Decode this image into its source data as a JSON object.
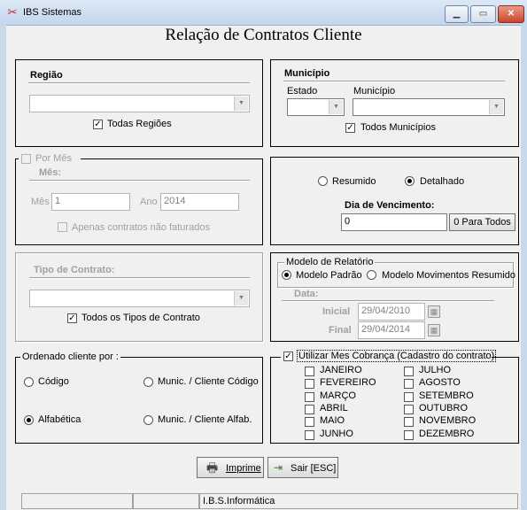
{
  "window": {
    "title": "IBS Sistemas",
    "app_icon": "ibs-logo-icon",
    "min": "▁",
    "max": "▭",
    "close": "✕"
  },
  "form_title": "Relação de Contratos Cliente",
  "regiao": {
    "title": "Região",
    "value": "",
    "todas_label": "Todas Regiões",
    "todas_checked": true
  },
  "municipio": {
    "title": "Município",
    "estado_label": "Estado",
    "municipio_label": "Município",
    "todos_label": "Todos Municípios",
    "todos_checked": true
  },
  "por_mes": {
    "legend": "Por Mês",
    "checked": false,
    "section": "Mês:",
    "mes_label": "Mês",
    "mes_value": "1",
    "ano_label": "Ano",
    "ano_value": "2014",
    "apenas_label": "Apenas contratos não faturados"
  },
  "tipo_saida": {
    "resumido": "Resumido",
    "detalhado": "Detalhado",
    "selected": "Detalhado",
    "dia_label": "Dia de Vencimento:",
    "dia_value": "0",
    "zero_button": "0 Para Todos"
  },
  "tipo_contrato": {
    "title": "Tipo de Contrato:",
    "value": "",
    "todos_label": "Todos os Tipos de Contrato",
    "todos_checked": true
  },
  "modelo": {
    "legend": "Modelo de Relatório",
    "padrao": "Modelo Padrão",
    "movimentos": "Modelo Movimentos Resumido",
    "selected": "Modelo Padrão",
    "data_label": "Data:",
    "inicial_label": "Inicial",
    "inicial_value": "29/04/2010",
    "final_label": "Final",
    "final_value": "29/04/2014"
  },
  "ordenado": {
    "legend": "Ordenado cliente por :",
    "codigo": "Código",
    "munic_codigo": "Munic. / Cliente Código",
    "alfabetica": "Alfabética",
    "munic_alfab": "Munic. / Cliente Alfab.",
    "selected": "Alfabética"
  },
  "cobranca": {
    "legend": "Utilizar Mes Cobrança (Cadastro do contrato)",
    "checked": true,
    "months_left": [
      "JANEIRO",
      "FEVEREIRO",
      "MARÇO",
      "ABRIL",
      "MAIO",
      "JUNHO"
    ],
    "months_right": [
      "JULHO",
      "AGOSTO",
      "SETEMBRO",
      "OUTUBRO",
      "NOVEMBRO",
      "DEZEMBRO"
    ]
  },
  "buttons": {
    "imprime": "Imprime",
    "sair": "Sair [ESC]"
  },
  "status": {
    "company": "I.B.S.Informática"
  },
  "colors": {
    "titlebar": "#c3d6ec",
    "close": "#c8472b",
    "background": "#f0f0f0"
  }
}
